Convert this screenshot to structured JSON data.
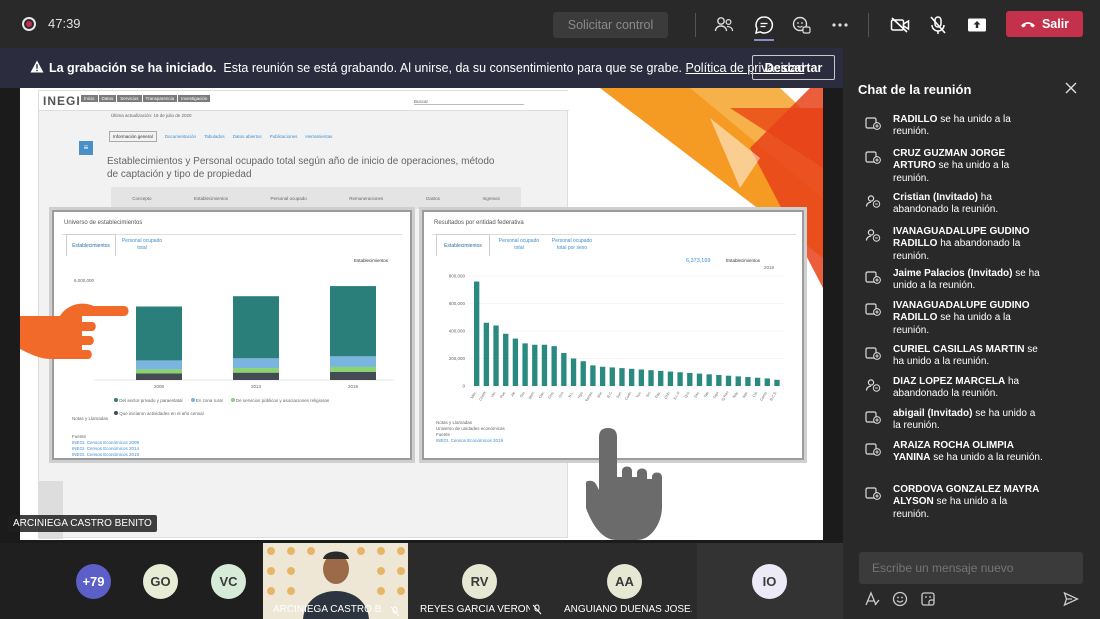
{
  "toolbar": {
    "timer": "47:39",
    "request_control": "Solicitar control",
    "leave": "Salir",
    "icons": [
      "participants-icon",
      "chat-icon",
      "reactions-icon",
      "more-icon",
      "camera-off-icon",
      "mic-off-icon",
      "share-icon",
      "phone-icon"
    ]
  },
  "banner": {
    "title": "La grabación se ha iniciado.",
    "message": "Esta reunión se está grabando. Al unirse, da su consentimiento para que se grabe.",
    "link": "Política de privacidad",
    "dismiss": "Descartar"
  },
  "slide": {
    "site_logo": "INEGI",
    "nav": [
      "Inicio",
      "Datos",
      "Servicios",
      "Transparencia",
      "Investigación"
    ],
    "search": "Buscar",
    "updated": "Última actualización: 16 de julio de 2020",
    "subtabs": [
      "Información general",
      "Documentación",
      "Tabulados",
      "Datos abiertos",
      "Publicaciones",
      "Herramientas"
    ],
    "heading": "Establecimientos y Personal ocupado total según año de inicio de operaciones, método de captación y tipo de propiedad",
    "table_headers": [
      "Concepto",
      "Establecimientos",
      "Personal ocupado",
      "Remuneraciones",
      "Gastos",
      "Ingresos"
    ],
    "left_panel": {
      "title": "Universo de establecimientos",
      "tabs": [
        "Establecimientos",
        "Personal ocupado total"
      ],
      "subtitle": "Establecimientos",
      "y_top": "6,000,000",
      "legend": [
        "Del sector privado y paraestatal",
        "En zona rural",
        "De servicios públicos y asociaciones religiosas",
        "Que iniciaron actividades en el año censal"
      ],
      "notes": "Notas y Llamadas",
      "source": "Fuente",
      "links": [
        "INEGI. Censos Económicos 2009",
        "INEGI. Censos Económicos 2014",
        "INEGI. Censos Económicos 2019"
      ]
    },
    "right_panel": {
      "title": "Resultados por entidad federativa",
      "tabs": [
        "Establecimientos",
        "Personal ocupado total",
        "Personal ocupado total por sexo"
      ],
      "total": "6,373,169",
      "total_label": "Establecimientos",
      "year": "2018",
      "notes": "Notas y Llamadas",
      "universe": "Universo de unidades económicas",
      "source": "Fuente",
      "link": "INEGI. Censos Económicos 2019"
    },
    "presenter_tag": "ARCINIEGA CASTRO BENITO"
  },
  "chart_data": [
    {
      "type": "bar",
      "stacked": true,
      "categories": [
        "2008",
        "2013",
        "2018"
      ],
      "ylim": [
        0,
        6000000
      ],
      "series": [
        {
          "name": "Del sector privado y paraestatal",
          "color": "#2a7f7a",
          "values": [
            3300000,
            3800000,
            4300000
          ]
        },
        {
          "name": "En zona rural",
          "color": "#7ab5e0",
          "values": [
            550000,
            600000,
            650000
          ]
        },
        {
          "name": "De servicios públicos y asociaciones religiosas",
          "color": "#8ad36e",
          "values": [
            250000,
            280000,
            300000
          ]
        },
        {
          "name": "Que iniciaron actividades en el año censal",
          "color": "#444b55",
          "values": [
            400000,
            450000,
            500000
          ]
        }
      ]
    },
    {
      "type": "bar",
      "categories": [
        "Méx.",
        "CDMX",
        "Ver.",
        "Pue.",
        "Jal.",
        "Gto.",
        "Mich.",
        "Oax.",
        "Chis.",
        "Gro.",
        "N.L.",
        "Hgo.",
        "Tamps.",
        "Mor.",
        "B.C.",
        "Son.",
        "Coah.",
        "Yuc.",
        "Sin.",
        "Tlax.",
        "Chih.",
        "S.L.P.",
        "Qro.",
        "Zac.",
        "Tab.",
        "Dgo.",
        "Q.Roo",
        "Nay.",
        "Ags.",
        "Col.",
        "Camp.",
        "B.C.S."
      ],
      "values": [
        760000,
        460000,
        440000,
        380000,
        345000,
        310000,
        300000,
        300000,
        290000,
        240000,
        200000,
        180000,
        150000,
        140000,
        135000,
        130000,
        125000,
        120000,
        115000,
        110000,
        105000,
        100000,
        95000,
        90000,
        85000,
        80000,
        75000,
        70000,
        65000,
        60000,
        55000,
        45000
      ],
      "ylim": [
        0,
        800000
      ],
      "yticks": [
        "800,000",
        "600,000",
        "400,000",
        "200,000",
        "0"
      ],
      "color": "#2a8a80"
    }
  ],
  "chat": {
    "title": "Chat de la reunión",
    "input_placeholder": "Escribe un mensaje nuevo",
    "messages": [
      {
        "name": "RADILLO",
        "text": "se ha unido a la reunión.",
        "icon": "join-icon"
      },
      {
        "name": "CRUZ GUZMAN JORGE ARTURO",
        "text": "se ha unido a la reunión.",
        "icon": "join-icon"
      },
      {
        "name": "Cristian (Invitado)",
        "text": "ha abandonado la reunión.",
        "icon": "leave-icon"
      },
      {
        "name": "IVANAGUADALUPE GUDINO RADILLO",
        "text": "ha abandonado la reunión.",
        "icon": "leave-icon"
      },
      {
        "name": "Jaime Palacios (Invitado)",
        "text": "se ha unido a la reunión.",
        "icon": "join-icon"
      },
      {
        "name": "IVANAGUADALUPE GUDINO RADILLO",
        "text": "se ha unido a la reunión.",
        "icon": "join-icon"
      },
      {
        "name": "CURIEL CASILLAS MARTIN",
        "text": "se ha unido a la reunión.",
        "icon": "join-icon"
      },
      {
        "name": "DIAZ LOPEZ MARCELA",
        "text": "ha abandonado la reunión.",
        "icon": "leave-icon"
      },
      {
        "name": "abigail (Invitado)",
        "text": "se ha unido a la reunión.",
        "icon": "join-icon"
      },
      {
        "name": "ARAIZA ROCHA OLIMPIA YANINA",
        "text": "se ha unido a la reunión.",
        "icon": "join-icon"
      },
      {
        "name": "CORDOVA GONZALEZ MAYRA ALYSON",
        "text": "se ha unido a la reunión.",
        "icon": "join-icon"
      }
    ]
  },
  "roster": {
    "more_count": "+79",
    "avatars": [
      {
        "initials": "GO",
        "color": "#e7ecd5"
      },
      {
        "initials": "VC",
        "color": "#d6ecd8"
      }
    ],
    "camera_name": "ARCINIEGA CASTRO B...",
    "tiles": [
      {
        "initials": "RV",
        "name": "REYES GARCIA VERON...",
        "color": "#e6e8d4"
      },
      {
        "initials": "AA",
        "name": "ANGUIANO DUEÑAS JOSE...",
        "color": "#e6e8d4"
      },
      {
        "initials": "IO",
        "name": "",
        "color": "#eceaf6"
      }
    ]
  }
}
